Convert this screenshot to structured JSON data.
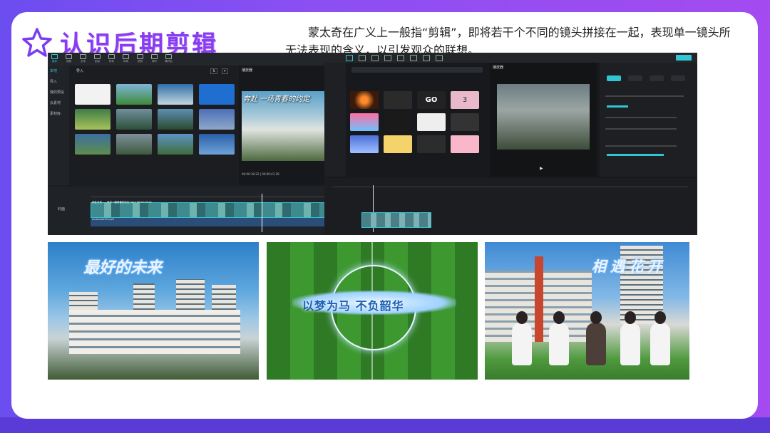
{
  "header": {
    "title": "认识后期剪辑",
    "description": "蒙太奇在广义上一般指“剪辑”，即将若干个不同的镜头拼接在一起，表现单一镜头所无法表现的含义，以引发观众的联想。"
  },
  "editor_left": {
    "top_tabs": [
      "媒体",
      "音频",
      "文本",
      "贴纸",
      "特效",
      "转场",
      "滤镜",
      "调节",
      "素材包"
    ],
    "sidebar": [
      "本地",
      "导入",
      "我的预设",
      "云素材",
      "素材库"
    ],
    "import_label": "导入",
    "player_label": "播放器",
    "player_overlay": "奔赴 一场青春的约定",
    "player_time": "00:00:18:22 | 00:00:41:28",
    "cover_label": "封面",
    "clip_label": "奔赴未来——风华一路青春的约定.mp4  00:00:19:01",
    "audio_label": "audionote03.mp3"
  },
  "editor_right": {
    "player_label": "播放器",
    "props_tabs": [
      "画面",
      "音频",
      "变速",
      "动画"
    ],
    "preset_tiles": [
      "GO",
      "3"
    ]
  },
  "images": [
    {
      "overlay": "最好的未来"
    },
    {
      "banner": "以梦为马 不负韶华"
    },
    {
      "overlay": "相遇花开"
    }
  ],
  "colors": {
    "accent": "#8a3df0",
    "teal": "#31c6d3"
  }
}
